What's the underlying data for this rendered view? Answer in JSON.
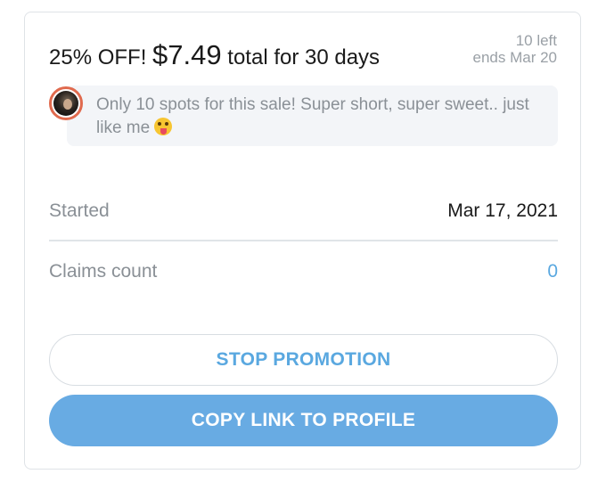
{
  "promo": {
    "discount": "25% OFF!",
    "price": "$7.49",
    "duration": "total for 30 days",
    "remaining": "10 left",
    "ends": "ends Mar 20",
    "message": "Only 10 spots for this sale! Super short, super sweet.. just like me",
    "message_emoji": "winking-face-with-tongue"
  },
  "details": {
    "started_label": "Started",
    "started_value": "Mar 17, 2021",
    "claims_label": "Claims count",
    "claims_value": "0"
  },
  "actions": {
    "stop_label": "STOP PROMOTION",
    "copy_label": "COPY LINK TO PROFILE"
  },
  "colors": {
    "accent": "#68abe3",
    "link": "#5aa8e0",
    "avatar_ring": "#e06a4e"
  }
}
